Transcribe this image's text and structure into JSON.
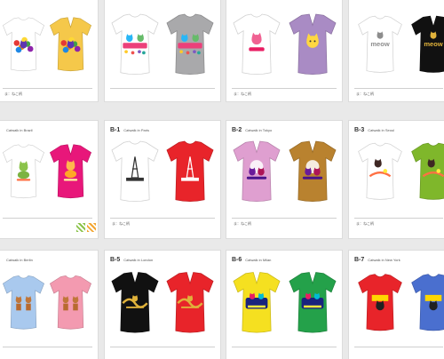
{
  "sheets": [
    {
      "id": "r1c1",
      "header": {
        "code": "",
        "title": ""
      },
      "footer": "ま：ねこ柄",
      "swatches": [],
      "shirts": [
        {
          "style": "crew",
          "color": "#ffffff",
          "print": "flower-cats"
        },
        {
          "style": "vneck",
          "color": "#f5c84a",
          "print": "flower-cats"
        }
      ]
    },
    {
      "id": "r1c2",
      "header": {
        "code": "",
        "title": ""
      },
      "footer": "",
      "swatches": [],
      "shirts": [
        {
          "style": "crew",
          "color": "#ffffff",
          "print": "party-cats"
        },
        {
          "style": "crew",
          "color": "#a9a9ab",
          "print": "party-cats"
        }
      ]
    },
    {
      "id": "r1c3",
      "header": {
        "code": "",
        "title": ""
      },
      "footer": "ま：ねこ柄",
      "swatches": [],
      "shirts": [
        {
          "style": "crew",
          "color": "#ffffff",
          "print": "pink-cat-heart"
        },
        {
          "style": "vneck",
          "color": "#a98bc4",
          "print": "yellow-cat-head"
        }
      ]
    },
    {
      "id": "r1c4",
      "header": {
        "code": "",
        "title": ""
      },
      "footer": "ま：ねこ柄",
      "swatches": [],
      "shirts": [
        {
          "style": "crew",
          "color": "#ffffff",
          "print": "meow-gray"
        },
        {
          "style": "vneck",
          "color": "#111111",
          "print": "meow-gold"
        }
      ]
    },
    {
      "id": "r2c1",
      "header": {
        "code": "",
        "title": "Catwalk in Brazil"
      },
      "footer": "",
      "swatches": [
        {
          "color": "#8bc34a"
        },
        {
          "color": "#f3a531"
        }
      ],
      "shirts": [
        {
          "style": "crew",
          "color": "#ffffff",
          "print": "green-cat"
        },
        {
          "style": "vneck",
          "color": "#e8177a",
          "print": "orange-cat"
        }
      ]
    },
    {
      "id": "r2c2",
      "header": {
        "code": "B-1",
        "title": "Catwalk in Paris"
      },
      "footer": "ま：ねこ柄",
      "swatches": [],
      "shirts": [
        {
          "style": "crew",
          "color": "#ffffff",
          "print": "paris-tower-dark"
        },
        {
          "style": "crew",
          "color": "#e8242a",
          "print": "paris-tower-light"
        }
      ]
    },
    {
      "id": "r2c3",
      "header": {
        "code": "B-2",
        "title": "Catwalk in Tokyo"
      },
      "footer": "ま：ねこ柄",
      "swatches": [],
      "shirts": [
        {
          "style": "vneck",
          "color": "#df9fd0",
          "print": "tokyo-cats"
        },
        {
          "style": "vneck",
          "color": "#b9822f",
          "print": "tokyo-cats"
        }
      ]
    },
    {
      "id": "r2c4",
      "header": {
        "code": "B-3",
        "title": "Catwalk in Seoul"
      },
      "footer": "ま：ねこ柄",
      "swatches": [],
      "shirts": [
        {
          "style": "crew",
          "color": "#ffffff",
          "print": "seoul-cats"
        },
        {
          "style": "crew",
          "color": "#7fb72b",
          "print": "seoul-cats"
        }
      ]
    },
    {
      "id": "r3c1",
      "header": {
        "code": "",
        "title": "Catwalk in Berlin"
      },
      "footer": "",
      "swatches": [],
      "shirts": [
        {
          "style": "crew",
          "color": "#a9c9ee",
          "print": "berlin-cats"
        },
        {
          "style": "crew",
          "color": "#f39ab0",
          "print": "berlin-cats"
        }
      ]
    },
    {
      "id": "r3c2",
      "header": {
        "code": "B-5",
        "title": "Catwalk in London"
      },
      "footer": "",
      "swatches": [],
      "shirts": [
        {
          "style": "vneck",
          "color": "#111111",
          "print": "london-gold"
        },
        {
          "style": "vneck",
          "color": "#e8242a",
          "print": "london-gold"
        }
      ]
    },
    {
      "id": "r3c3",
      "header": {
        "code": "B-6",
        "title": "Catwalk in Milan"
      },
      "footer": "",
      "swatches": [],
      "shirts": [
        {
          "style": "vneck",
          "color": "#f5e020",
          "print": "milan-cats"
        },
        {
          "style": "vneck",
          "color": "#24a14a",
          "print": "milan-cats"
        }
      ]
    },
    {
      "id": "r3c4",
      "header": {
        "code": "B-7",
        "title": "Catwalk in New York"
      },
      "footer": "",
      "swatches": [],
      "shirts": [
        {
          "style": "crew",
          "color": "#e8242a",
          "print": "ny-cats"
        },
        {
          "style": "crew",
          "color": "#4a6fcf",
          "print": "ny-cats"
        }
      ]
    }
  ]
}
